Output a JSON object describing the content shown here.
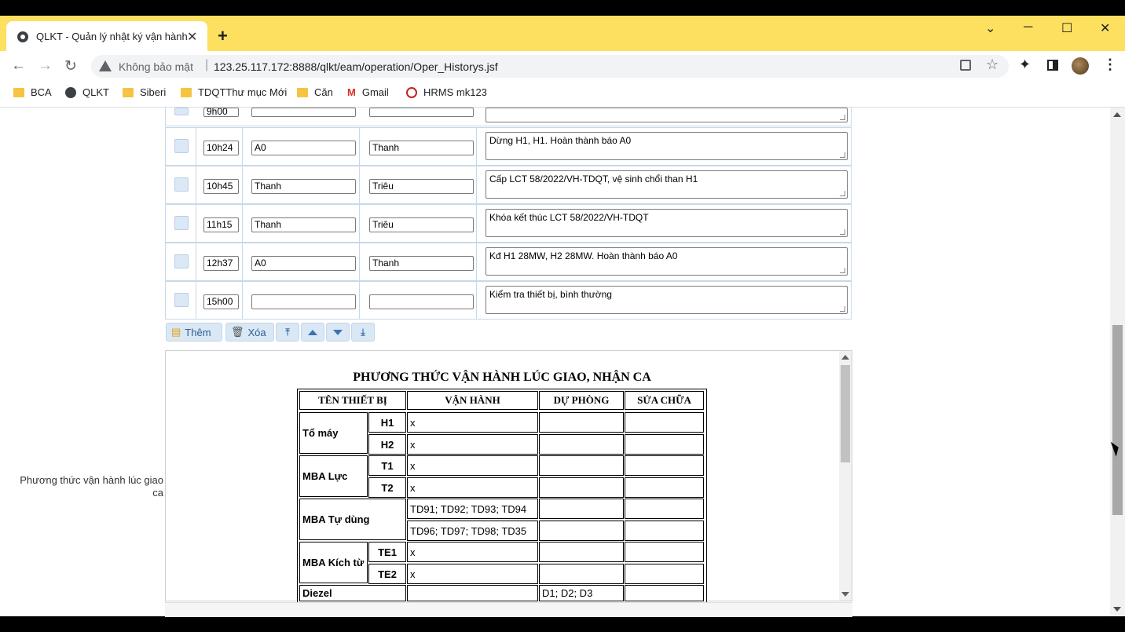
{
  "browser": {
    "tab_title": "QLKT - Quản lý nhật ký vận hành",
    "close_glyph": "✕",
    "new_tab_glyph": "+",
    "security_label": "Không bảo mật",
    "url": "123.25.117.172:8888/qlkt/eam/operation/Oper_Historys.jsf",
    "bookmarks": [
      "BCA",
      "QLKT",
      "Siberi",
      "TDQTThư mục Mới",
      "Căn",
      "Gmail",
      "HRMS mk123"
    ],
    "colors": {
      "tabbar": "#fde05f"
    }
  },
  "log": {
    "partial_time": "9h00",
    "rows": [
      {
        "time": "10h24",
        "from": "A0",
        "to": "Thanh",
        "note": "Dừng H1, H1. Hoàn thành báo A0"
      },
      {
        "time": "10h45",
        "from": "Thanh",
        "to": "Triêu",
        "note": "Cấp LCT 58/2022/VH-TDQT, vệ sinh chổi than H1"
      },
      {
        "time": "11h15",
        "from": "Thanh",
        "to": "Triêu",
        "note": "Khóa kết thúc  LCT 58/2022/VH-TDQT"
      },
      {
        "time": "12h37",
        "from": "A0",
        "to": "Thanh",
        "note": "Kđ H1 28MW, H2 28MW. Hoàn thành báo A0"
      },
      {
        "time": "15h00",
        "from": "",
        "to": "",
        "note": "Kiểm tra thiết bị, bình thường"
      }
    ],
    "add_label": "Thêm",
    "delete_label": "Xóa"
  },
  "side_label": "Phương thức vận hành lúc giao ca",
  "doc": {
    "title": "PHƯƠNG THỨC VẬN HÀNH LÚC GIAO, NHẬN CA",
    "headers": [
      "TÊN THIẾT BỊ",
      "VẬN HÀNH",
      "DỰ PHÒNG",
      "SỬA CHỮA"
    ],
    "groups": [
      {
        "name": "Tổ máy",
        "rows": [
          {
            "sub": "H1",
            "vh": "x",
            "dp": "",
            "sc": ""
          },
          {
            "sub": "H2",
            "vh": "x",
            "dp": "",
            "sc": ""
          }
        ]
      },
      {
        "name": "MBA Lực",
        "rows": [
          {
            "sub": "T1",
            "vh": "x",
            "dp": "",
            "sc": ""
          },
          {
            "sub": "T2",
            "vh": "x",
            "dp": "",
            "sc": ""
          }
        ]
      },
      {
        "name": "MBA Tự dùng",
        "rows": [
          {
            "sub": "",
            "vh": "TD91; TD92; TD93; TD94",
            "dp": "",
            "sc": ""
          },
          {
            "sub": "",
            "vh": "TD96; TD97; TD98; TD35",
            "dp": "",
            "sc": ""
          }
        ]
      },
      {
        "name": "MBA Kích từ",
        "rows": [
          {
            "sub": "TE1",
            "vh": "x",
            "dp": "",
            "sc": ""
          },
          {
            "sub": "TE2",
            "vh": "x",
            "dp": "",
            "sc": ""
          }
        ]
      }
    ],
    "diezel": {
      "name": "Diezel",
      "vh": "",
      "dp": "D1; D2; D3",
      "sc": ""
    }
  }
}
